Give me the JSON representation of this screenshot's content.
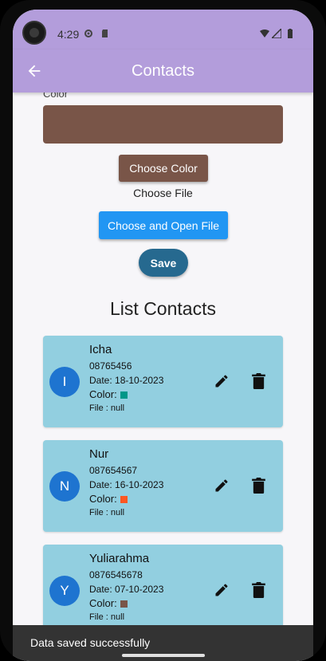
{
  "status": {
    "time": "4:29"
  },
  "appbar": {
    "title": "Contacts"
  },
  "form": {
    "color_label": "Color",
    "choose_color_label": "Choose Color",
    "choose_file_label": "Choose File",
    "open_file_label": "Choose and Open File",
    "save_label": "Save",
    "selected_color": "#795548"
  },
  "list": {
    "title": "List Contacts",
    "contacts": [
      {
        "initial": "I",
        "name": "Icha",
        "phone": "08765456",
        "date": "Date: 18-10-2023",
        "color_label": "Color:",
        "color": "#009688",
        "file": "File : null"
      },
      {
        "initial": "N",
        "name": "Nur",
        "phone": "087654567",
        "date": "Date: 16-10-2023",
        "color_label": "Color:",
        "color": "#ff5722",
        "file": "File : null"
      },
      {
        "initial": "Y",
        "name": "Yuliarahma",
        "phone": "0876545678",
        "date": "Date: 07-10-2023",
        "color_label": "Color:",
        "color": "#795548",
        "file": "File : null"
      }
    ]
  },
  "snackbar": {
    "message": "Data saved successfully"
  }
}
